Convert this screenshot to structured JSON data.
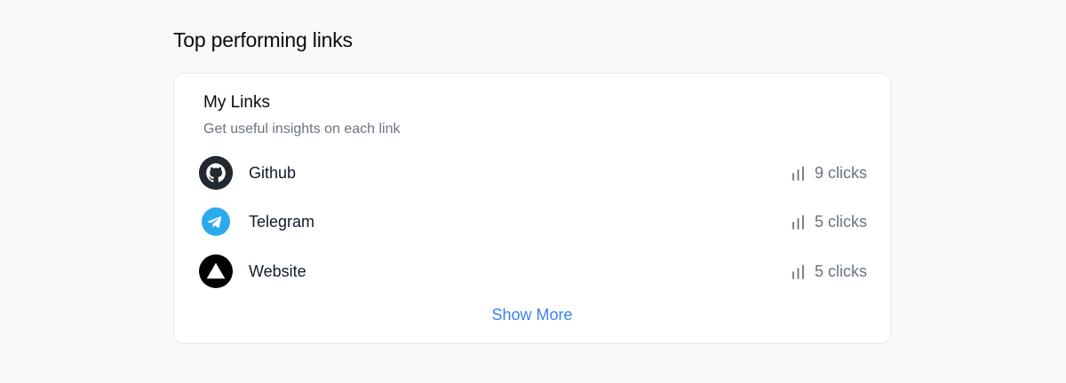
{
  "section": {
    "title": "Top performing links"
  },
  "card": {
    "title": "My Links",
    "subtitle": "Get useful insights on each link",
    "show_more_label": "Show More"
  },
  "links": [
    {
      "name": "Github",
      "clicks": "9 clicks",
      "icon": "github-icon"
    },
    {
      "name": "Telegram",
      "clicks": "5 clicks",
      "icon": "telegram-icon"
    },
    {
      "name": "Website",
      "clicks": "5 clicks",
      "icon": "website-icon"
    }
  ],
  "colors": {
    "accent": "#3b82f6",
    "muted_text": "#6b7280",
    "telegram": "#2AABEE",
    "github": "#24292f",
    "website": "#000000"
  }
}
